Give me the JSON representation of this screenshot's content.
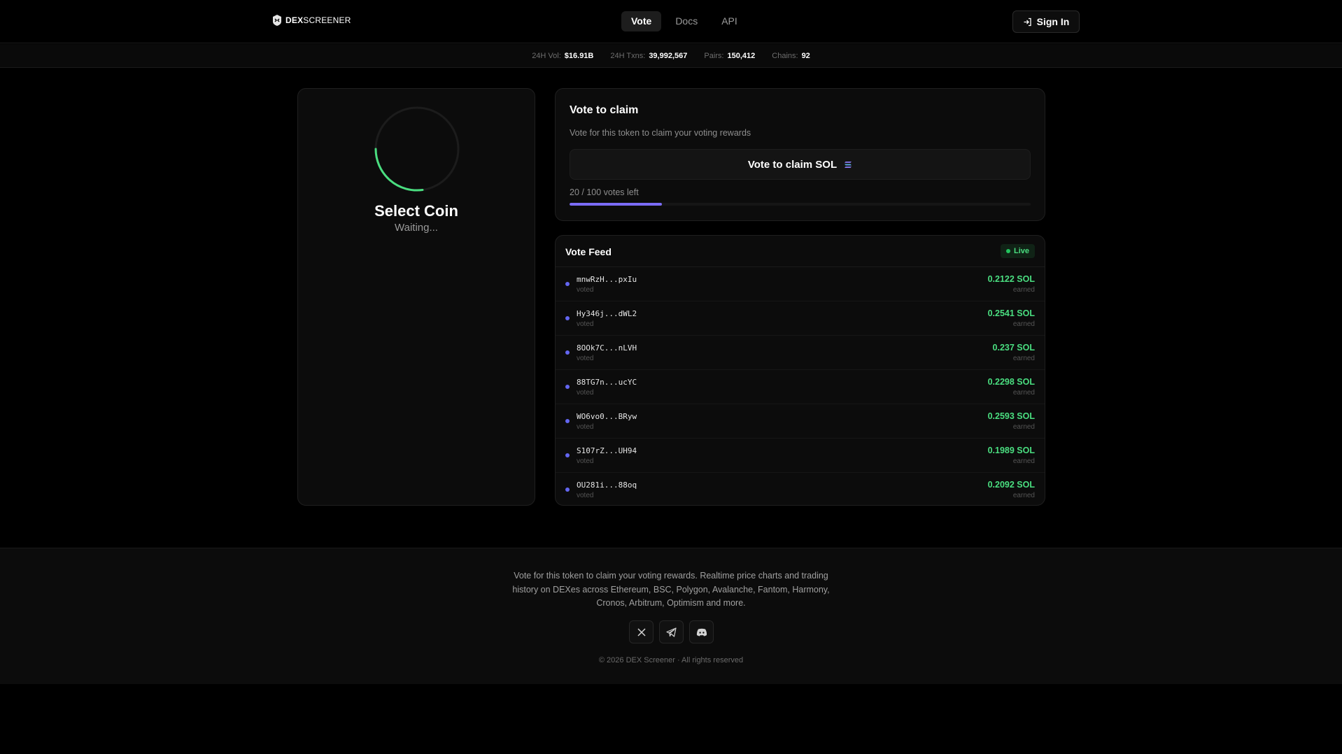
{
  "header": {
    "logo": {
      "bold": "DEX",
      "rest": "SCREENER"
    },
    "nav": [
      {
        "label": "Vote",
        "active": true
      },
      {
        "label": "Docs",
        "active": false
      },
      {
        "label": "API",
        "active": false
      }
    ],
    "sign_in_label": "Sign In"
  },
  "stats": [
    {
      "label": "24H Vol:",
      "value": "$16.91B"
    },
    {
      "label": "24H Txns:",
      "value": "39,992,567"
    },
    {
      "label": "Pairs:",
      "value": "150,412"
    },
    {
      "label": "Chains:",
      "value": "92"
    }
  ],
  "coin": {
    "title": "Select Coin",
    "status": "Waiting..."
  },
  "claim": {
    "title": "Vote to claim",
    "description": "Vote for this token to claim your voting rewards",
    "button_label": "Vote to claim SOL",
    "votes_left": "20 / 100 votes left",
    "progress_fraction": 0.2
  },
  "feed": {
    "title": "Vote Feed",
    "live_label": "Live",
    "items": [
      {
        "address": "mnwRzH...pxIu",
        "action": "voted",
        "amount": "0.2122 SOL",
        "note": "earned"
      },
      {
        "address": "Hy346j...dWL2",
        "action": "voted",
        "amount": "0.2541 SOL",
        "note": "earned"
      },
      {
        "address": "8OOk7C...nLVH",
        "action": "voted",
        "amount": "0.237 SOL",
        "note": "earned"
      },
      {
        "address": "88TG7n...ucYC",
        "action": "voted",
        "amount": "0.2298 SOL",
        "note": "earned"
      },
      {
        "address": "WO6vo0...BRyw",
        "action": "voted",
        "amount": "0.2593 SOL",
        "note": "earned"
      },
      {
        "address": "S107rZ...UH94",
        "action": "voted",
        "amount": "0.1989 SOL",
        "note": "earned"
      },
      {
        "address": "OU281i...88oq",
        "action": "voted",
        "amount": "0.2092 SOL",
        "note": "earned"
      }
    ]
  },
  "footer": {
    "text": "Vote for this token to claim your voting rewards. Realtime price charts and trading history on DEXes across Ethereum, BSC, Polygon, Avalanche, Fantom, Harmony, Cronos, Arbitrum, Optimism and more.",
    "socials": [
      "x-icon",
      "telegram-icon",
      "discord-icon"
    ],
    "copyright": "© 2026 DEX Screener · All rights reserved"
  },
  "colors": {
    "accent_green": "#4ade80",
    "accent_purple": "#7b6cf6",
    "feed_dot": "#6366f1"
  }
}
